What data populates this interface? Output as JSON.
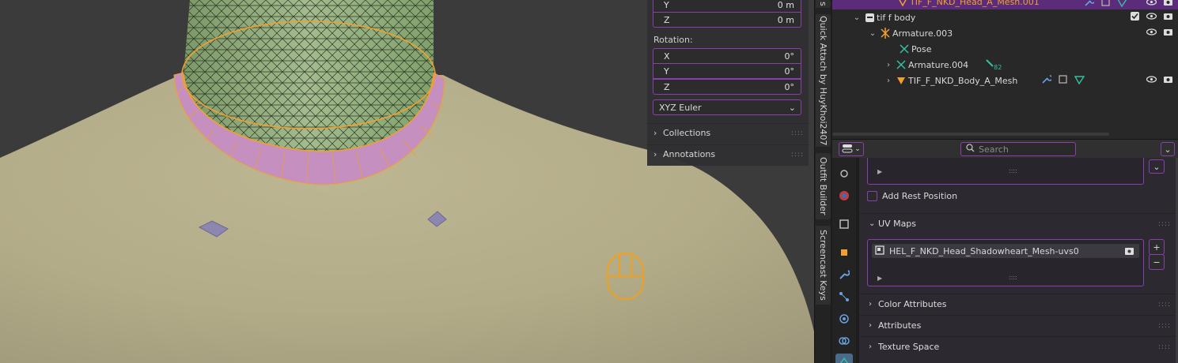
{
  "npanel": {
    "loc_y": {
      "axis": "Y",
      "value": "0 m"
    },
    "loc_z": {
      "axis": "Z",
      "value": "0 m"
    },
    "rotation_label": "Rotation:",
    "rot_x": {
      "axis": "X",
      "value": "0°"
    },
    "rot_y": {
      "axis": "Y",
      "value": "0°"
    },
    "rot_z": {
      "axis": "Z",
      "value": "0°"
    },
    "rotation_mode": "XYZ Euler",
    "collections": "Collections",
    "annotations": "Annotations"
  },
  "vertical_tabs": [
    "Quick Attach by HuyKhoi2407",
    "Outfit Builder",
    "Screencast Keys"
  ],
  "outliner": {
    "rows": [
      {
        "label": "TIF_F_NKD_Head_A_Mesh.001",
        "icon": "mesh-icon"
      },
      {
        "label": "tif f body",
        "icon": "collection-icon"
      },
      {
        "label": "Armature.003",
        "icon": "armature-icon"
      },
      {
        "label": "Pose",
        "icon": "pose-icon"
      },
      {
        "label": "Armature.004",
        "icon": "armature-data-icon",
        "badge": "82"
      },
      {
        "label": "TIF_F_NKD_Body_A_Mesh",
        "icon": "mesh-icon"
      }
    ]
  },
  "properties": {
    "search_placeholder": "Search",
    "add_rest_position": "Add Rest Position",
    "uv_maps": "UV Maps",
    "uv_map_name": "HEL_F_NKD_Head_Shadowheart_Mesh-uvs0",
    "sections": [
      "Color Attributes",
      "Attributes",
      "Texture Space"
    ]
  },
  "colors": {
    "accent": "#8a3fb0",
    "selection_orange": "#f0a030",
    "highlight_row": "#5a2c7a",
    "skin": "#b3ac88",
    "head_mesh": "#9cb487",
    "neck_faces": "#c58fbf"
  }
}
